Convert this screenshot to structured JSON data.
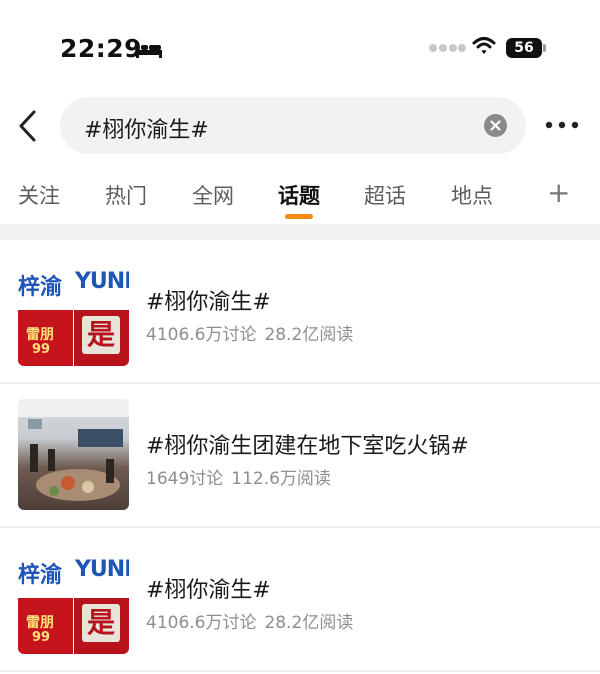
{
  "status_bar": {
    "time": "22:29",
    "battery": "56"
  },
  "search": {
    "query": "#栩你渝生#"
  },
  "tabs": [
    {
      "label": "关注"
    },
    {
      "label": "热门"
    },
    {
      "label": "全网"
    },
    {
      "label": "话题",
      "active": true
    },
    {
      "label": "超话"
    },
    {
      "label": "地点"
    }
  ],
  "tab_plus": "+",
  "results": [
    {
      "title": "#栩你渝生#",
      "discussions": "4106.6万讨论",
      "reads": "28.2亿阅读",
      "thumb": "brand"
    },
    {
      "title": "#栩你渝生团建在地下室吃火锅#",
      "discussions": "1649讨论",
      "reads": "112.6万阅读",
      "thumb": "photo"
    },
    {
      "title": "#栩你渝生#",
      "discussions": "4106.6万讨论",
      "reads": "28.2亿阅读",
      "thumb": "brand"
    }
  ],
  "thumb_brand": {
    "cn": "梓渝",
    "en": "YUNI",
    "poster_a": "雷朋",
    "poster_b": "99",
    "poster_c": "是"
  },
  "colors": {
    "accent": "#f38a14",
    "brand_blue": "#1f56b8",
    "poster_red": "#c5141c"
  }
}
